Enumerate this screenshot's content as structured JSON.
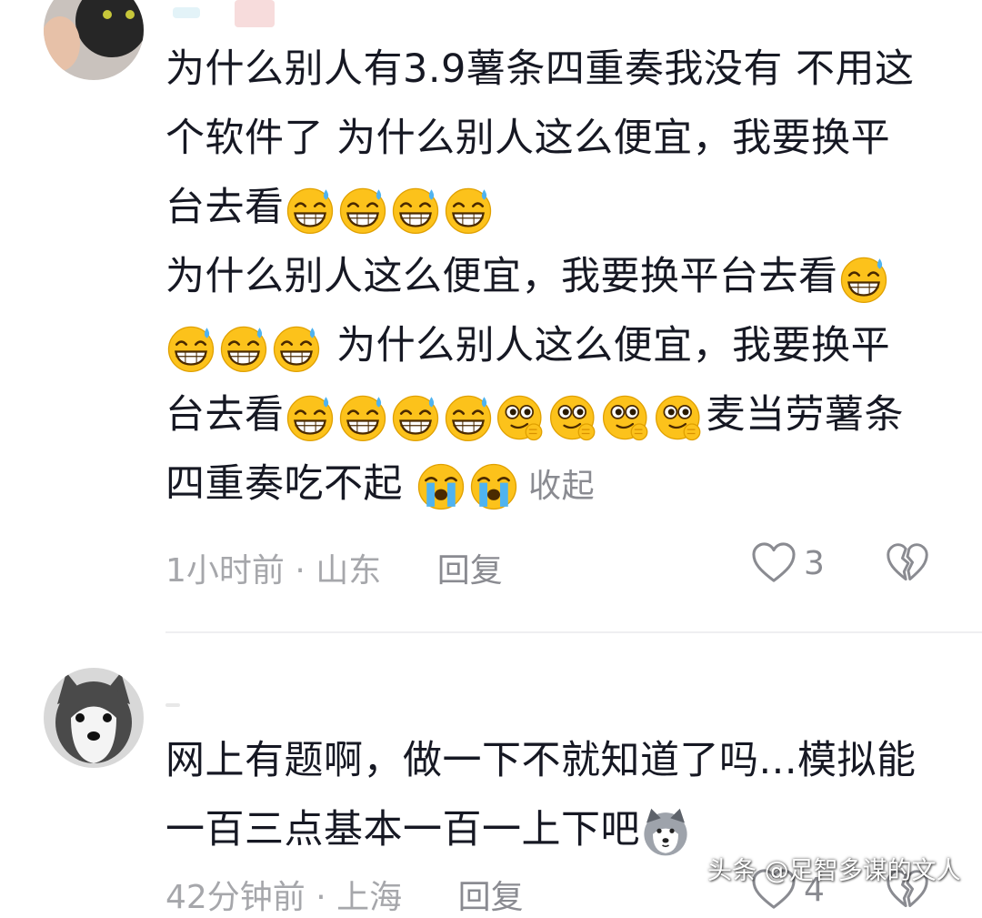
{
  "comments": [
    {
      "avatar": "cat-avatar",
      "text_line_1": "为什么别人有3.9薯条四重奏我没有 不用这",
      "text_line_2": "个软件了 为什么别人这么便宜，我要换平",
      "text_line_3a": "台去看",
      "text_line_4a": "为什么别人这么便宜，我要换平台去看",
      "text_line_5b": "为什么别人这么便宜，我要换平",
      "text_line_6a": "台去看",
      "text_line_6b": "麦当劳薯条",
      "text_line_7a": "四重奏吃不起",
      "collapse": "收起",
      "time": "1小时前",
      "separator": "·",
      "location": "山东",
      "reply": "回复",
      "likes": "3"
    },
    {
      "avatar": "husky-avatar",
      "text_line_1": "网上有题啊，做一下不就知道了吗...模拟能",
      "text_line_2": "一百三点基本一百一上下吧",
      "time": "42分钟前",
      "separator": "·",
      "location": "上海",
      "reply": "回复",
      "likes": "4"
    }
  ],
  "watermark": "头条 @足智多谋的文人",
  "icons": {
    "sweat_grin": "grin-sweat-emoji-icon",
    "yum": "yum-emoji-icon",
    "crying": "crying-emoji-icon",
    "husky": "husky-emoji-icon",
    "like": "heart-icon",
    "dislike": "broken-heart-icon"
  },
  "colors": {
    "text": "#161823",
    "meta": "#a6a7ab",
    "divider": "#efeff1"
  }
}
